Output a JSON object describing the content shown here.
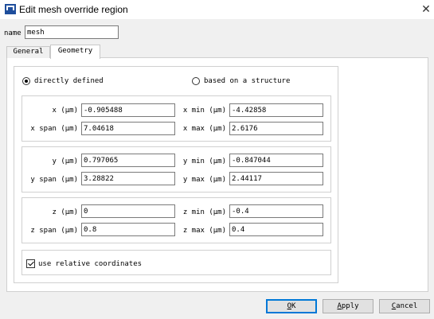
{
  "window": {
    "title": "Edit mesh override region",
    "close_glyph": "✕"
  },
  "name_field": {
    "label": "name",
    "value": "mesh"
  },
  "tabs": [
    {
      "label": "General",
      "active": false
    },
    {
      "label": "Geometry",
      "active": true
    }
  ],
  "mode": {
    "options": [
      {
        "label": "directly defined",
        "selected": true
      },
      {
        "label": "based on a structure",
        "selected": false
      }
    ]
  },
  "x": {
    "center_label": "x (μm)",
    "center_value": "-0.905488",
    "span_label": "x span (μm)",
    "span_value": "7.04618",
    "min_label": "x min (μm)",
    "min_value": "-4.42858",
    "max_label": "x max (μm)",
    "max_value": "2.6176"
  },
  "y": {
    "center_label": "y (μm)",
    "center_value": "0.797065",
    "span_label": "y span (μm)",
    "span_value": "3.28822",
    "min_label": "y min (μm)",
    "min_value": "-0.847044",
    "max_label": "y max (μm)",
    "max_value": "2.44117"
  },
  "z": {
    "center_label": "z (μm)",
    "center_value": "0",
    "span_label": "z span (μm)",
    "span_value": "0.8",
    "min_label": "z min (μm)",
    "min_value": "-0.4",
    "max_label": "z max (μm)",
    "max_value": "0.4"
  },
  "relative_coordinates": {
    "label": "use relative coordinates",
    "checked": true
  },
  "buttons": {
    "ok": {
      "mnemonic": "O",
      "rest": "K"
    },
    "apply": {
      "mnemonic": "A",
      "rest": "pply"
    },
    "cancel": {
      "mnemonic": "C",
      "rest": "ancel"
    }
  },
  "colors": {
    "accent": "#0078d7",
    "icon": "#1f4e9c"
  }
}
